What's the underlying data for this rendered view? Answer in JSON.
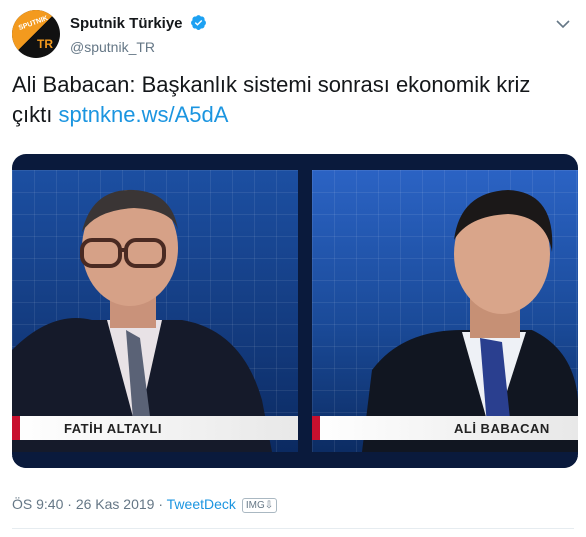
{
  "account": {
    "display_name": "Sputnik Türkiye",
    "handle": "@sputnik_TR",
    "avatar_text_top": "SPUTNIK",
    "avatar_text_bottom": "TR"
  },
  "tweet": {
    "text": "Ali Babacan: Başkanlık sistemi sonrası ekonomik kriz çıktı ",
    "link": "sptnkne.ws/A5dA"
  },
  "media": {
    "left_caption": "FATİH ALTAYLI",
    "right_caption": "ALİ BABACAN"
  },
  "meta": {
    "time": "ÖS 9:40",
    "separator": " · ",
    "date": "26 Kas 2019",
    "source": "TweetDeck",
    "badge": "IMG⇩"
  },
  "colors": {
    "link": "#1b95e0",
    "verified": "#1da1f2",
    "brand_orange": "#f39a1e",
    "caption_red": "#c8102e"
  },
  "icons": [
    "verified-badge-icon",
    "chevron-down-icon"
  ]
}
